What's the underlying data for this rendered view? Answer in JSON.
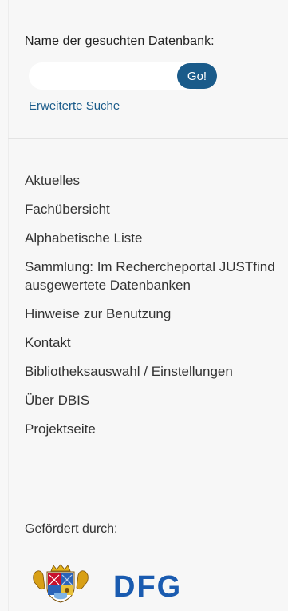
{
  "search": {
    "label": "Name der gesuchten Datenbank:",
    "value": "",
    "placeholder": "",
    "go_label": "Go!",
    "advanced_link": "Erweiterte Suche"
  },
  "nav": {
    "items": [
      {
        "label": "Aktuelles"
      },
      {
        "label": "Fachübersicht"
      },
      {
        "label": "Alphabetische Liste"
      },
      {
        "label": "Sammlung: Im Rechercheportal JUSTfind ausgewertete Datenbanken"
      },
      {
        "label": "Hinweise zur Benutzung"
      },
      {
        "label": "Kontakt"
      },
      {
        "label": "Bibliotheksauswahl / Einstellungen"
      },
      {
        "label": "Über DBIS"
      },
      {
        "label": "Projektseite"
      }
    ]
  },
  "funding": {
    "label": "Gefördert durch:",
    "logos": [
      {
        "icon": "bavaria-coat-of-arms-icon"
      },
      {
        "icon": "dfg-logo",
        "text": "DFG"
      }
    ]
  },
  "colors": {
    "accent": "#1a5b8a",
    "dfg_blue": "#1a5bb0",
    "background": "#f7f7f7",
    "text": "#333333"
  }
}
